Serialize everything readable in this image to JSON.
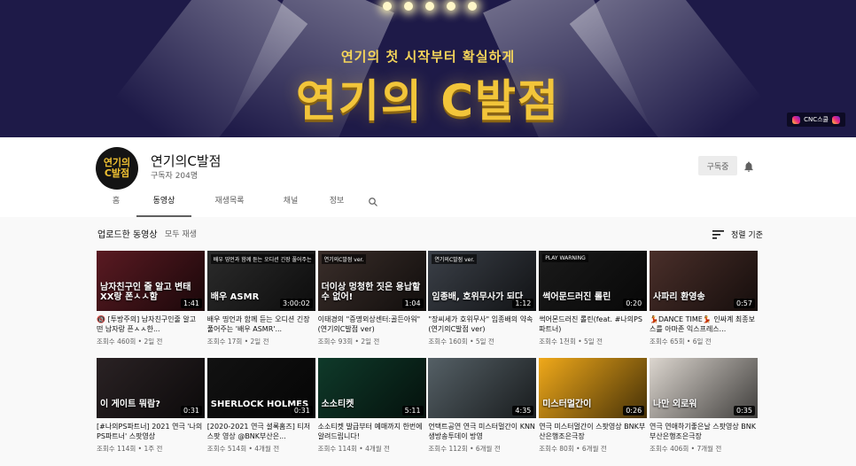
{
  "banner": {
    "subtitle": "연기의 첫 시작부터 확실하게",
    "title": "연기의 C발점",
    "badge": "CNC스쿨"
  },
  "channel": {
    "avatar_text": "연기의 C발점",
    "name": "연기의C발점",
    "subscribers": "구독자 204명",
    "subscribe_label": "구독중"
  },
  "tabs": [
    {
      "label": "홈"
    },
    {
      "label": "동영상"
    },
    {
      "label": "재생목록"
    },
    {
      "label": "채널"
    },
    {
      "label": "정보"
    }
  ],
  "section": {
    "title": "업로드한 동영상",
    "play_all": "모두 재생",
    "sort_label": "정렬 기준"
  },
  "videos": [
    {
      "title": "🔞 [투방주의] 남자친구인줄 알고 떤 남자랑 픈ㅅㅅ한...",
      "meta": "조회수 460회 • 2일 전",
      "duration": "1:41",
      "thumb_text": "남자친구인 줄 알고 변태XX랑 폰ㅅㅅ함",
      "thumb_tag": "",
      "bg": "#5a1a22"
    },
    {
      "title": "배우 띵언과 함께 듣는 오디션 긴장 풀어주는 '배우 ASMR'...",
      "meta": "조회수 17회 • 2일 전",
      "duration": "3:00:02",
      "thumb_text": "배우 ASMR",
      "thumb_tag": "배우 띵언과 함께 듣는 오디션 긴장 풀어주는",
      "bg": "#2b2b2b"
    },
    {
      "title": "이태경의 \"증명외상센터:골든아워\" (연기의C발점 ver)",
      "meta": "조회수 93회 • 2일 전",
      "duration": "1:04",
      "thumb_text": "더이상 멍청한 짓은 용납할 수 없어!",
      "thumb_tag": "연기의C발점 ver.",
      "bg": "#3a2e2a"
    },
    {
      "title": "\"장씨세가 호위무사\" 임종배의 약속 (연기의C발점 ver)",
      "meta": "조회수 160회 • 5일 전",
      "duration": "1:12",
      "thumb_text": "임종배, 호위무사가 되다",
      "thumb_tag": "연기의C발점 ver.",
      "bg": "#3b4048"
    },
    {
      "title": "썩어몬드러진 롤린(feat. #나의PS파트너)",
      "meta": "조회수 1천회 • 5일 전",
      "duration": "0:20",
      "thumb_text": "썩어문드러진 롤린",
      "thumb_tag": "PLAY WARNING",
      "bg": "#1a1a1a"
    },
    {
      "title": "💃DANCE TIME💃 인싸계 최종보스를 아마존 익스프레스...",
      "meta": "조회수 65회 • 6일 전",
      "duration": "0:57",
      "thumb_text": "사파리 환영송",
      "thumb_tag": "",
      "bg": "#4a2f2a"
    },
    {
      "title": "[#나의PS파트너] 2021 연극 '나의PS파트너' 스팟영상",
      "meta": "조회수 114회 • 1주 전",
      "duration": "0:31",
      "thumb_text": "이 게이트 뭐람?",
      "thumb_tag": "",
      "bg": "#2a2224"
    },
    {
      "title": "[2020-2021 연극 셜록홈즈] 티저 스팟 영상 @BNK부산은...",
      "meta": "조회수 514회 • 4개월 전",
      "duration": "0:31",
      "thumb_text": "SHERLOCK HOLMES",
      "thumb_tag": "",
      "bg": "#121212"
    },
    {
      "title": "소소티켓 발급부터 예매까지 한번에 알려드립니다!",
      "meta": "조회수 114회 • 4개월 전",
      "duration": "5:11",
      "thumb_text": "소소티켓",
      "thumb_tag": "",
      "bg": "#0f3a2a"
    },
    {
      "title": "언택트공연 연극 미스터멀간이 KNN 생방송투데이 방영",
      "meta": "조회수 112회 • 6개월 전",
      "duration": "4:35",
      "thumb_text": "",
      "thumb_tag": "",
      "bg": "#556066"
    },
    {
      "title": "연극 미스터멀간이 스팟영상 BNK부산은행조은극장",
      "meta": "조회수 80회 • 6개월 전",
      "duration": "0:26",
      "thumb_text": "미스터멀간이",
      "thumb_tag": "",
      "bg": "#f0a91a"
    },
    {
      "title": "연극 연애하기좋은날 스팟영상 BNK부산은행조은극장",
      "meta": "조회수 406회 • 7개월 전",
      "duration": "0:35",
      "thumb_text": "나만 외로워",
      "thumb_tag": "",
      "bg": "#dcd6cf"
    }
  ],
  "icons": {
    "bell": "bell-icon",
    "search": "search-icon",
    "sort": "sort-icon"
  }
}
